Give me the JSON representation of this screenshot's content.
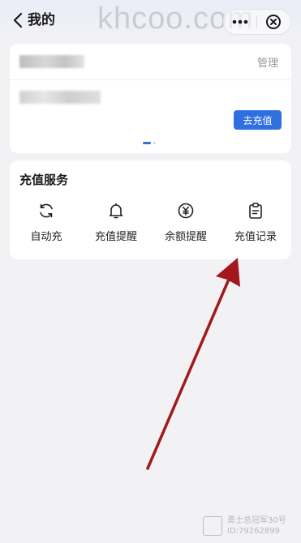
{
  "header": {
    "title": "我的",
    "watermark": "khcoo.com",
    "more_icon": "more-icon",
    "close_icon": "close-circle-icon"
  },
  "account_card": {
    "manage_label": "管理",
    "recharge_label": "去充值",
    "accent_color": "#2f6fe0"
  },
  "services": {
    "title": "充值服务",
    "items": [
      {
        "label": "自动充",
        "icon": "refresh-icon"
      },
      {
        "label": "充值提醒",
        "icon": "bell-icon"
      },
      {
        "label": "余额提醒",
        "icon": "yen-icon"
      },
      {
        "label": "充值记录",
        "icon": "clipboard-icon"
      }
    ]
  },
  "footer_watermark": {
    "line1": "勇士总冠军30号",
    "line2": "ID:79262899"
  }
}
